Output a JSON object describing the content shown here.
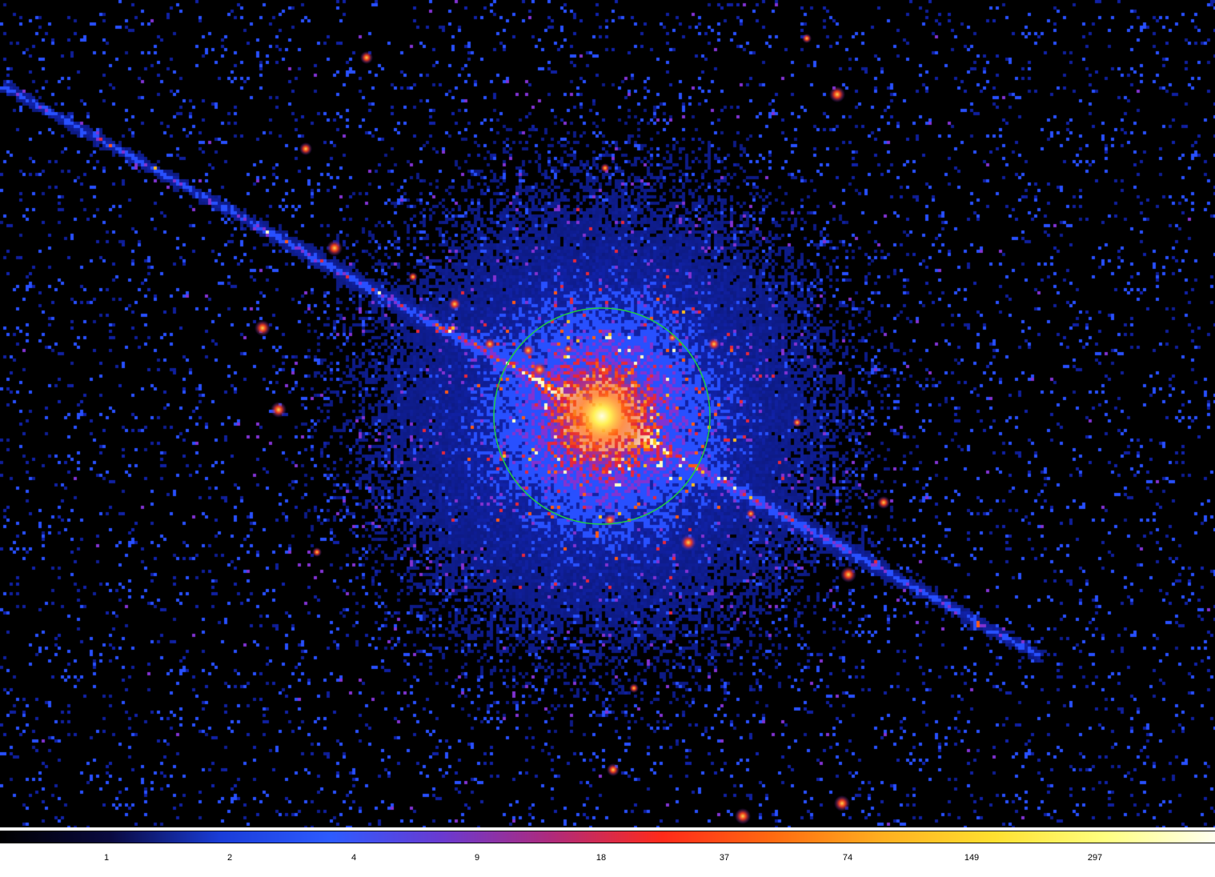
{
  "colorbar": {
    "ticks": [
      {
        "value": "1"
      },
      {
        "value": "2"
      },
      {
        "value": "4"
      },
      {
        "value": "9"
      },
      {
        "value": "18"
      },
      {
        "value": "37"
      },
      {
        "value": "74"
      },
      {
        "value": "149"
      },
      {
        "value": "297"
      }
    ],
    "colormap": [
      "#000000",
      "#0a0a40",
      "#1a3dd9",
      "#2e5bff",
      "#6a3ad0",
      "#b02a7a",
      "#ff2a1a",
      "#ff6a10",
      "#ffb020",
      "#ffe030",
      "#ffff80",
      "#fffff0"
    ]
  },
  "region": {
    "shape": "circle",
    "color": "#22cc44"
  }
}
